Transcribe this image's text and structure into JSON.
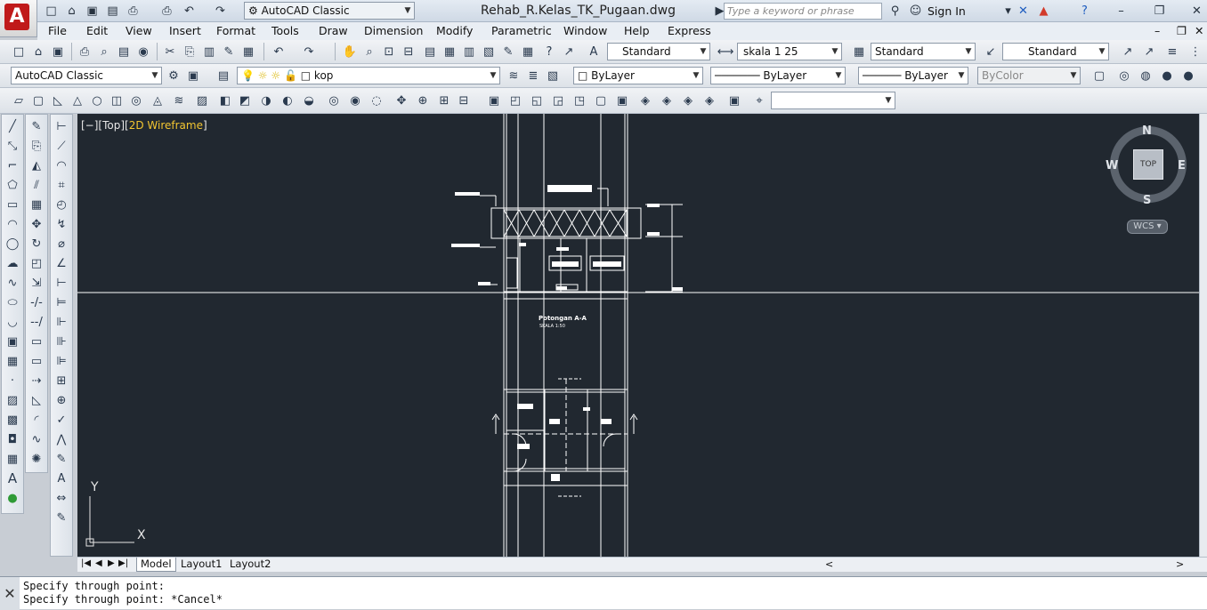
{
  "window": {
    "title": "Rehab_R.Kelas_TK_Pugaan.dwg",
    "workspace": "AutoCAD Classic",
    "search_placeholder": "Type a keyword or phrase",
    "sign_in": "Sign In"
  },
  "menu": [
    "File",
    "Edit",
    "View",
    "Insert",
    "Format",
    "Tools",
    "Draw",
    "Dimension",
    "Modify",
    "Parametric",
    "Window",
    "Help",
    "Express"
  ],
  "styles_toolbar": {
    "text_style": "Standard",
    "dim_style": "skala 1 25",
    "table_style": "Standard",
    "mleader_style": "Standard"
  },
  "layers_toolbar": {
    "workspace": "AutoCAD Classic",
    "layer": "kop",
    "color": "ByLayer",
    "linetype": "ByLayer",
    "lineweight": "ByLayer",
    "plotstyle": "ByColor"
  },
  "viewport": {
    "bracket": "[−][Top][",
    "mode": "2D Wireframe",
    "close": "]",
    "section_label": "Potongan A-A",
    "scale_label": "SKALA 1:50"
  },
  "viewcube": {
    "n": "N",
    "s": "S",
    "e": "E",
    "w": "W",
    "face": "TOP",
    "ucs": "WCS"
  },
  "ucs_icon": {
    "x": "X",
    "y": "Y"
  },
  "layout_tabs": [
    "Model",
    "Layout1",
    "Layout2"
  ],
  "command_line": {
    "line1": "Specify through point:",
    "line2": "Specify through point: *Cancel*"
  },
  "colors": {
    "canvas": "#212830",
    "wireframe": "#f2c531",
    "drawing": "#ffffff"
  }
}
